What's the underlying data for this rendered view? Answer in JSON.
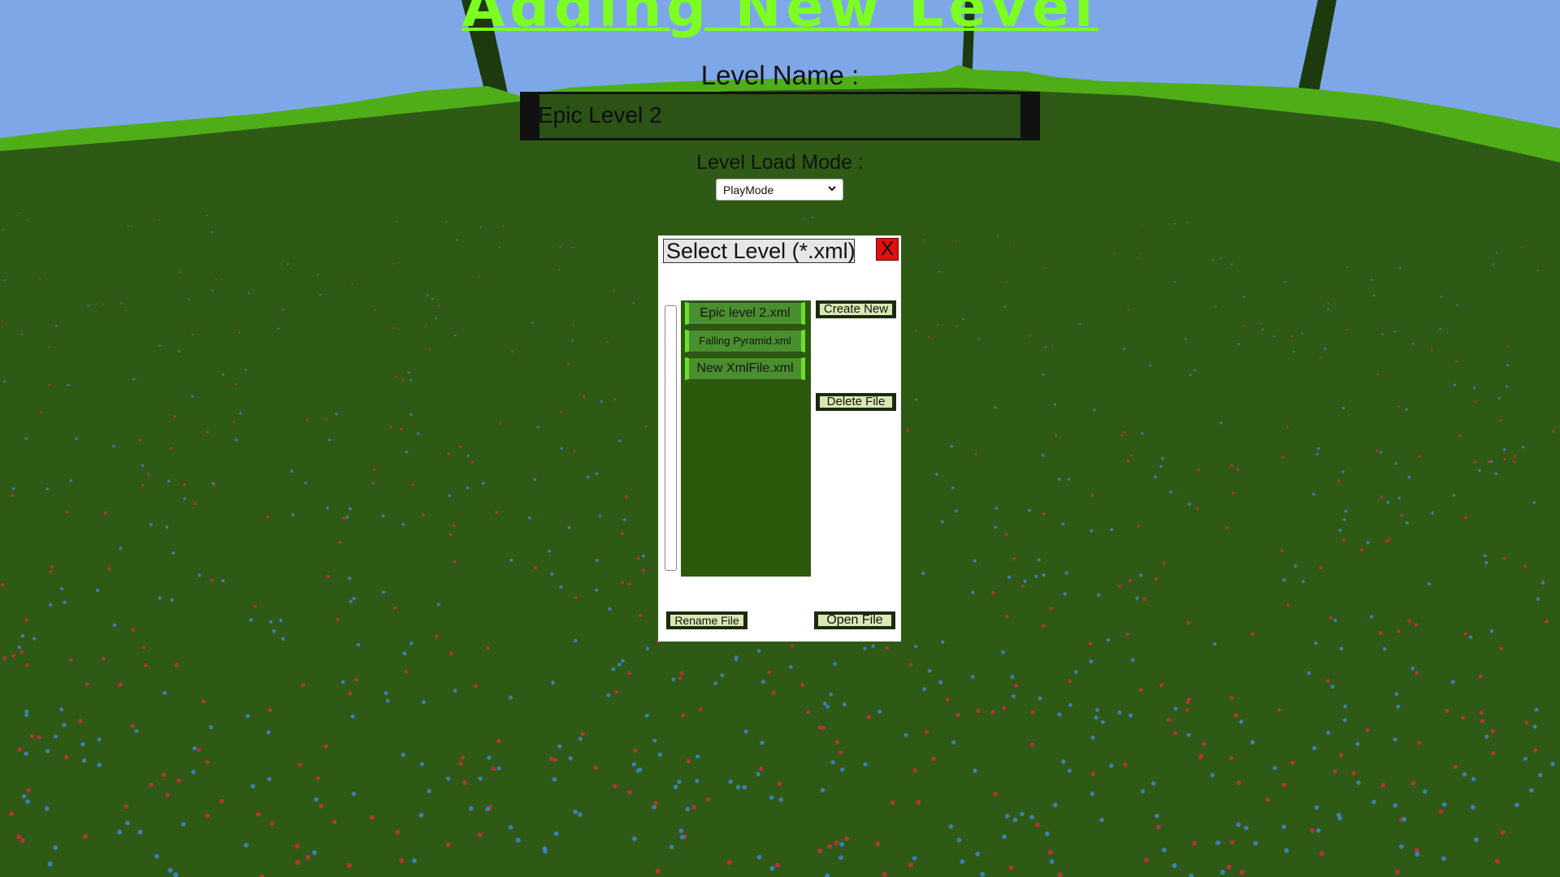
{
  "header": {
    "title": "Adding New Level",
    "level_name_label": "Level Name :",
    "level_name_value": "Epic Level 2",
    "load_mode_label": "Level Load Mode :",
    "load_mode_value": "PlayMode"
  },
  "dialog": {
    "title": "Select Level (*.xml)",
    "close_label": "X",
    "files": [
      {
        "name": "Epic level 2.xml"
      },
      {
        "name": "Falling Pyramid.xml"
      },
      {
        "name": "New XmlFile.xml"
      }
    ],
    "buttons": {
      "create_new": "Create New",
      "delete_file": "Delete File",
      "rename_file": "Rename File",
      "open_file": "Open File"
    }
  },
  "colors": {
    "title": "#7cff21",
    "sky": "#7ea7e8",
    "grass": "#2f5a15",
    "close": "#e01010",
    "list": "#2c5a0c"
  }
}
